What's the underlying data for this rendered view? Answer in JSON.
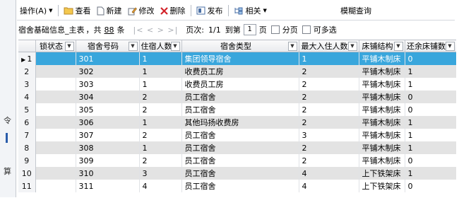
{
  "toolbar": {
    "operate": "操作(A)",
    "view": "查看",
    "new": "新建",
    "edit": "修改",
    "delete": "删除",
    "publish": "发布",
    "related": "相关",
    "fuzzy_query": "模糊查询"
  },
  "left_strip": {
    "glyph_a": "令",
    "glyph_b": "算"
  },
  "pager": {
    "title": "宿舍基础信息_主表",
    "total_prefix": "，共",
    "total": "88",
    "total_suffix": "条",
    "nav": "|< < > >|",
    "page_label": "页次:",
    "page_value": "1/1",
    "goto_label": "到第",
    "goto_value": "1",
    "page_unit": "页",
    "paging_label": "分页",
    "multiselect_label": "可多选"
  },
  "grid": {
    "columns": [
      "锁状态",
      "宿舍号码",
      "住宿人数",
      "宿舍类型",
      "最大入住人数",
      "床铺结构",
      "还余床铺数"
    ],
    "rows": [
      {
        "n": "1",
        "lock": "",
        "room": "301",
        "count": "1",
        "type": "集团领导宿舍",
        "max": "1",
        "bed": "平铺木制床",
        "left": "0"
      },
      {
        "n": "2",
        "lock": "",
        "room": "302",
        "count": "1",
        "type": "收费员工房",
        "max": "2",
        "bed": "平铺木制床",
        "left": "1"
      },
      {
        "n": "3",
        "lock": "",
        "room": "303",
        "count": "1",
        "type": "收费员工房",
        "max": "2",
        "bed": "平铺木制床",
        "left": "1"
      },
      {
        "n": "4",
        "lock": "",
        "room": "304",
        "count": "2",
        "type": "员工宿舍",
        "max": "2",
        "bed": "平铺木制床",
        "left": "0"
      },
      {
        "n": "5",
        "lock": "",
        "room": "305",
        "count": "2",
        "type": "员工宿舍",
        "max": "2",
        "bed": "平铺木制床",
        "left": "0"
      },
      {
        "n": "6",
        "lock": "",
        "room": "306",
        "count": "1",
        "type": "其他玛扬收费房",
        "max": "2",
        "bed": "平铺木制床",
        "left": "1"
      },
      {
        "n": "7",
        "lock": "",
        "room": "307",
        "count": "2",
        "type": "员工宿舍",
        "max": "3",
        "bed": "平铺木制床",
        "left": "1"
      },
      {
        "n": "8",
        "lock": "",
        "room": "308",
        "count": "1",
        "type": "员工宿舍",
        "max": "2",
        "bed": "平铺木制床",
        "left": "1"
      },
      {
        "n": "9",
        "lock": "",
        "room": "309",
        "count": "2",
        "type": "员工宿舍",
        "max": "2",
        "bed": "平铺木制床",
        "left": "0"
      },
      {
        "n": "10",
        "lock": "",
        "room": "310",
        "count": "3",
        "type": "员工宿舍",
        "max": "4",
        "bed": "上下铁架床",
        "left": "1"
      },
      {
        "n": "11",
        "lock": "",
        "room": "311",
        "count": "4",
        "type": "员工宿舍",
        "max": "4",
        "bed": "上下铁架床",
        "left": "0"
      }
    ]
  },
  "colors": {
    "selected_row": "#39a6dc",
    "alt_row": "#e3e3e3"
  }
}
